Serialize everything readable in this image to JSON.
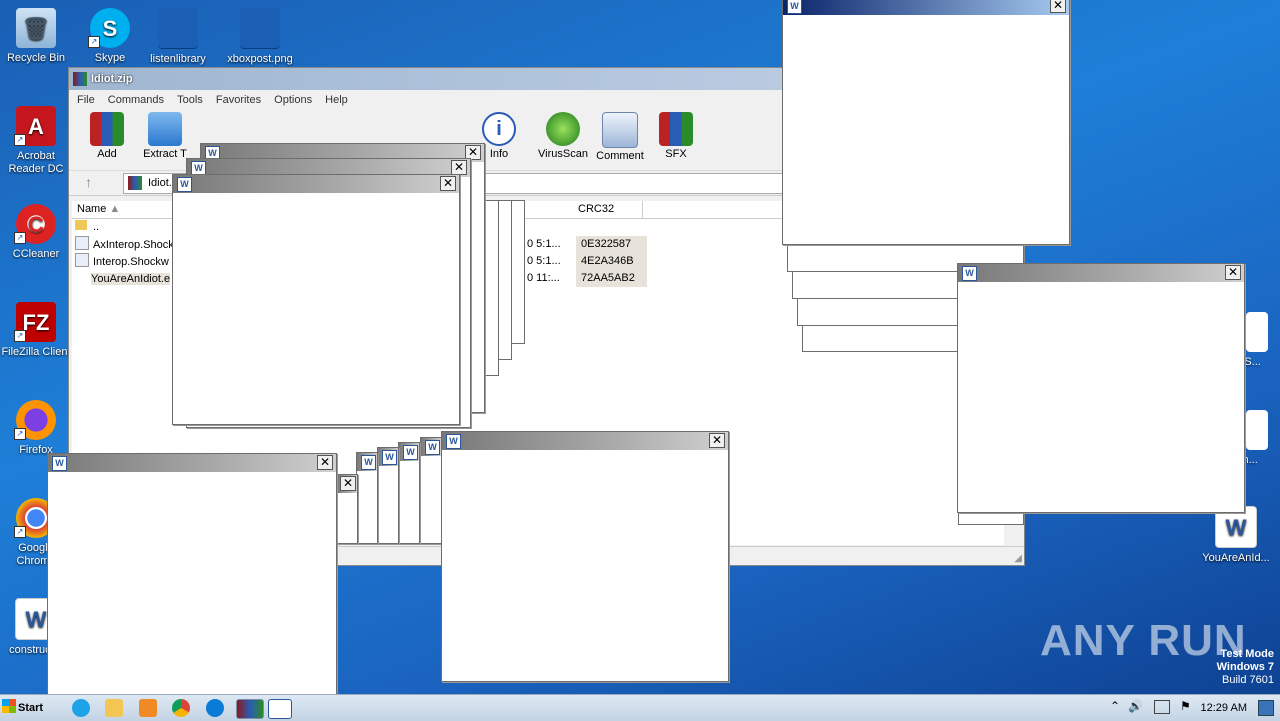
{
  "desktop": {
    "icons": [
      {
        "label": "Recycle Bin"
      },
      {
        "label": "Skype"
      },
      {
        "label": "listenlibrary"
      },
      {
        "label": "xboxpost.png"
      },
      {
        "label": "Acrobat Reader DC"
      },
      {
        "label": "CCleaner"
      },
      {
        "label": "FileZilla Client"
      },
      {
        "label": "Firefox"
      },
      {
        "label": "Google Chrome"
      },
      {
        "label": "construct..."
      },
      {
        "label": "YouAreAnId..."
      },
      {
        "label": "...p.S..."
      },
      {
        "label": "...Sh..."
      }
    ]
  },
  "winrar": {
    "title": "Idiot.zip",
    "menu": [
      "File",
      "Commands",
      "Tools",
      "Favorites",
      "Options",
      "Help"
    ],
    "toolbar": [
      "Add",
      "Extract T",
      "Info",
      "VirusScan",
      "Comment",
      "SFX"
    ],
    "address": "Idiot.",
    "columns": {
      "name": "Name",
      "crc": "CRC32"
    },
    "rows": [
      {
        "name": "..",
        "modified": "",
        "crc": ""
      },
      {
        "name": "AxInterop.Shock",
        "modified": "0 5:1...",
        "crc": "0E322587"
      },
      {
        "name": "Interop.Shockw",
        "modified": "0 5:1...",
        "crc": "4E2A346B"
      },
      {
        "name": "YouAreAnIdiot.e",
        "modified": "0 11:...",
        "crc": "72AA5AB2"
      }
    ]
  },
  "popup_close_glyph": "✕",
  "popup_icon_glyph": "W",
  "taskbar": {
    "start_label": "Start",
    "clock": "12:29 AM"
  },
  "watermark": "ANY RUN",
  "system": {
    "line1": "Test Mode",
    "line2": "Windows 7",
    "line3": "Build 7601"
  },
  "colors": {
    "desktop_blue": "#1e7fd8",
    "popup_title_gray": "#787878",
    "popup_title_blue": "#0a246a"
  }
}
